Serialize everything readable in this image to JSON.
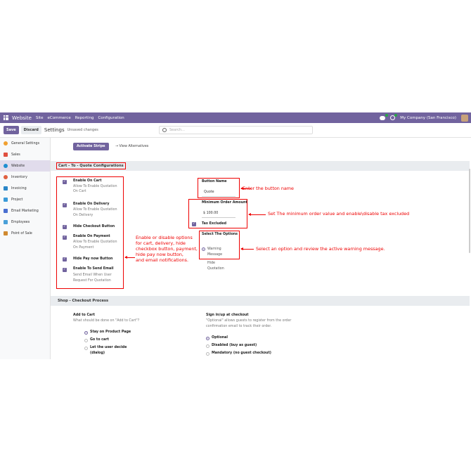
{
  "topbar": {
    "brand": "Website",
    "menu": [
      "Site",
      "eCommerce",
      "Reporting",
      "Configuration"
    ],
    "company": "My Company (San Francisco)"
  },
  "control": {
    "save": "Save",
    "discard": "Discard",
    "title": "Settings",
    "status": "Unsaved changes",
    "search_placeholder": "Search..."
  },
  "sidebar": {
    "items": [
      {
        "label": "General Settings",
        "color": "#f0a030"
      },
      {
        "label": "Sales",
        "color": "#e05040"
      },
      {
        "label": "Website",
        "color": "#1f8fd0"
      },
      {
        "label": "Inventory",
        "color": "#e06040"
      },
      {
        "label": "Invoicing",
        "color": "#2a86c8"
      },
      {
        "label": "Project",
        "color": "#3a9ad8"
      },
      {
        "label": "Email Marketing",
        "color": "#4a6fd0"
      },
      {
        "label": "Employees",
        "color": "#4aa0d8"
      },
      {
        "label": "Point of Sale",
        "color": "#d08a30"
      }
    ]
  },
  "main": {
    "activate_stripe": "Activate Stripe",
    "view_alternatives": "→  View Alternatives",
    "cart_section": "Cart - To - Quote Configurations",
    "options": [
      {
        "title": "Enable On Cart",
        "desc": [
          "Allow To Enable Quotation",
          "On Cart"
        ]
      },
      {
        "title": "Enable On Delivery",
        "desc": [
          "Allow To Enable Quotation",
          "On Delivery"
        ]
      },
      {
        "title": "Hide Checkout Button",
        "desc": []
      },
      {
        "title": "Enable On Payment",
        "desc": [
          "Allow To Enable Quotation",
          "On Payment"
        ]
      },
      {
        "title": "Hide Pay now Button",
        "desc": []
      },
      {
        "title": "Enable To Send Email",
        "desc": [
          "Send Email When User",
          "Request For Quotation"
        ]
      }
    ],
    "button_name_label": "Button Name",
    "button_name_value": "Quote",
    "min_order_label": "Minimum Order Amount",
    "min_order_value": "$ 100.00",
    "tax_excluded": "Tax Excluded",
    "select_options_label": "Select The Options",
    "select_option_1": [
      "Warning",
      "Message"
    ],
    "select_option_2": [
      "Hide",
      "Quotation"
    ],
    "notes": {
      "options": [
        "Enable or disable options",
        "for cart, delivery, hide",
        "checkbox button, payment,",
        "hide pay now button,",
        "and email notifications."
      ],
      "button_name": "Enter the button name",
      "min_order": "Set The minimum order value and enable\\disable tax excluded",
      "select": "Select an option and review the active warning message."
    },
    "shop_section": "Shop - Checkout Process",
    "add_to_cart": {
      "title": "Add to Cart",
      "desc": "What should be done on \"Add to Cart\"?",
      "choices": [
        "Stay on Product Page",
        "Go to cart",
        "Let the user decide",
        "(dialog)"
      ]
    },
    "signin": {
      "title": "Sign in/up at checkout",
      "desc": [
        "\"Optional\" allows guests to register from the order",
        "confirmation email to track their order."
      ],
      "choices": [
        "Optional",
        "Disabled (buy as guest)",
        "Mandatory (no guest checkout)"
      ]
    }
  }
}
